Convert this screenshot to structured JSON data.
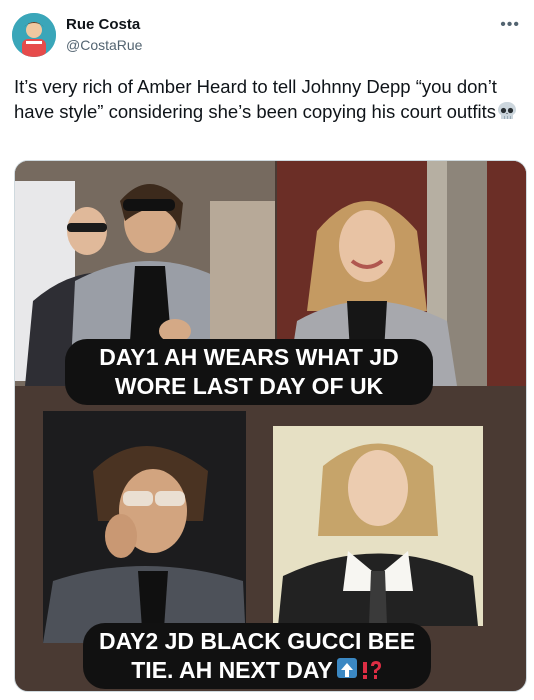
{
  "user": {
    "name": "Rue Costa",
    "handle": "@CostaRue"
  },
  "more_icon": "more-horizontal-icon",
  "tweet": {
    "text": "It’s very rich of Amber Heard to tell Johnny Depp “you don’t have style” considering she’s been copying his court outfits",
    "emoji": "skull-emoji"
  },
  "media": {
    "caption1_line1": "DAY1 AH WEARS WHAT JD",
    "caption1_line2": "WORE LAST DAY OF UK",
    "caption2_line1": "DAY2 JD BLACK GUCCI BEE",
    "caption2_line2": "TIE. AH NEXT DAY",
    "caption2_emojis": [
      "up-arrow-emoji",
      "exclamation-question-emoji"
    ]
  },
  "colors": {
    "up_arrow_bg": "#3b88c3",
    "exclamation": "#dd2e44"
  }
}
